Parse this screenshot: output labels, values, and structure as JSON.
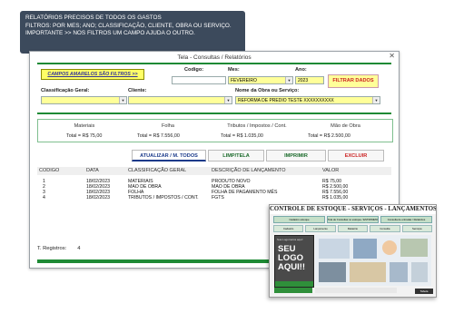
{
  "banner": {
    "line1": "RELATÓRIOS PRECISOS DE TODOS OS GASTOS",
    "line2": "FILTROS: POR MES; ANO; CLASSIFICAÇÃO, CLIENTE, OBRA OU SERVIÇO.",
    "line3": "IMPORTANTE >> NOS FILTROS UM CAMPO AJUDA O OUTRO."
  },
  "window": {
    "title": "Tela - Consultas / Relatórios",
    "close_glyph": "✕"
  },
  "filters": {
    "yellow_button": "CAMPOS AMARELOS SÃO FILTROS >>",
    "codigo_label": "Codigo:",
    "mes_label": "Mes:",
    "mes_value": "FEVEREIRO",
    "ano_label": "Ano:",
    "ano_value": "2023",
    "filter_button": "FILTRAR DADOS",
    "classificacao_label": "Classificação Geral:",
    "cliente_label": "Cliente:",
    "obra_label": "Nome da Obra ou Serviço:",
    "obra_value": "REFORMA DE PREDIO TESTE XXXXXXXXXX"
  },
  "totals": [
    {
      "label": "Materiais",
      "total_label": "Total =",
      "value": "R$ 75,00"
    },
    {
      "label": "Folha",
      "total_label": "Total =",
      "value": "R$ 7.556,00"
    },
    {
      "label": "Tributos / Impostos / Cont.",
      "total_label": "Total =",
      "value": "R$ 1.035,00"
    },
    {
      "label": "Mão de Obra",
      "total_label": "Total =",
      "value": "R$ 2.500,00"
    }
  ],
  "actions": {
    "atualizar": "ATUALIZAR / M. TODOS",
    "limp": "LIMP/TELA",
    "imprimir": "IMPRIMIR",
    "excluir": "EXCLUIR"
  },
  "table": {
    "headers": [
      "CODIGO",
      "DATA",
      "CLASSIFICAÇÃO GERAL",
      "DESCRIÇÃO DE LANÇAMENTO",
      "VALOR"
    ],
    "rows": [
      [
        "1",
        "18/02/2023",
        "MATERIAIS",
        "PRODUTO NOVO",
        "R$ 75,00"
      ],
      [
        "2",
        "18/02/2023",
        "MAO DE OBRA",
        "MAO DE OBRA",
        "R$ 2.500,00"
      ],
      [
        "3",
        "18/02/2023",
        "FOLHA",
        "FOLHA DE PAGAMENTO MÊS",
        "R$ 7.556,00"
      ],
      [
        "4",
        "18/02/2023",
        "TRIBUTOS / IMPOSTOS / CONT.",
        "FGTS",
        "R$ 1.035,00"
      ]
    ]
  },
  "footer": {
    "registros_label": "T. Registros:",
    "registros_value": "4"
  },
  "promo": {
    "title": "CONTROLE DE ESTOQUE - SERVIÇOS - LANÇAMENTOS",
    "nav1": [
      "Cadastro estoque",
      "Tela de Consultas no estoque / ESTMINIMO",
      "Consulta de entradas / Relatórios"
    ],
    "nav2": [
      "Cadastro",
      "Lançamento",
      "Relatório",
      "Consulta",
      "Serviços"
    ],
    "logo_small": "Sua Logomarca aqui!",
    "logo_big": "SEU LOGO AQUI!!",
    "corner": "Tabela"
  }
}
